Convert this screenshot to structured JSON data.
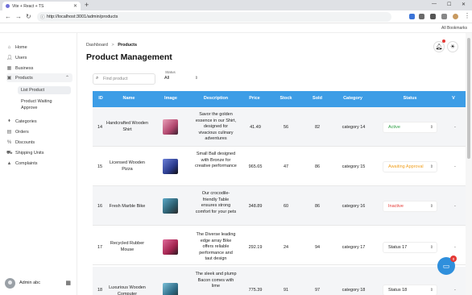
{
  "browser": {
    "tab_title": "Vite + React + TS",
    "url": "http://localhost:3001/admin/products",
    "bookmarks_label": "All Bookmarks"
  },
  "sidebar": {
    "items": [
      {
        "label": "Home",
        "icon": "home-icon"
      },
      {
        "label": "Users",
        "icon": "user-icon"
      },
      {
        "label": "Business",
        "icon": "business-icon"
      },
      {
        "label": "Products",
        "icon": "products-icon"
      },
      {
        "label": "Categories",
        "icon": "tag-icon"
      },
      {
        "label": "Orders",
        "icon": "orders-icon"
      },
      {
        "label": "Discounts",
        "icon": "discount-icon"
      },
      {
        "label": "Shipping Units",
        "icon": "truck-icon"
      },
      {
        "label": "Complaints",
        "icon": "warning-icon"
      }
    ],
    "subitems": [
      {
        "label": "List Product"
      },
      {
        "label": "Product Waiting Approve"
      }
    ],
    "user_name": "Admin abc"
  },
  "header": {
    "breadcrumb_root": "Dashboard",
    "breadcrumb_sep": ">",
    "breadcrumb_current": "Products",
    "title": "Product Management"
  },
  "filters": {
    "search_placeholder": "Find product",
    "status_label": "Status",
    "status_value": "All"
  },
  "table": {
    "headers": [
      "ID",
      "Name",
      "Image",
      "Description",
      "Price",
      "Stock",
      "Sold",
      "Category",
      "Status",
      "V"
    ],
    "rows": [
      {
        "id": "14",
        "name": "Handcrafted Wooden Shirt",
        "desc": "Savor the golden essence in our Shirt, designed for vivacious culinary adventures",
        "price": "41.49",
        "stock": "56",
        "sold": "82",
        "category": "category 14",
        "status": "Active",
        "status_color": "#2e9e44"
      },
      {
        "id": "15",
        "name": "Licensed Wooden Pizza",
        "desc": "Small Ball designed with Bronze for creative performance",
        "price": "965.65",
        "stock": "47",
        "sold": "86",
        "category": "category 15",
        "status": "Awaiting Approval",
        "status_color": "#f0a020"
      },
      {
        "id": "16",
        "name": "Fresh Marble Bike",
        "desc": "Our crocodile-friendly Table ensures strong comfort for your pets",
        "price": "348.89",
        "stock": "60",
        "sold": "86",
        "category": "category 16",
        "status": "Inactive",
        "status_color": "#e53935"
      },
      {
        "id": "17",
        "name": "Recycled Rubber Mouse",
        "desc": "The Diverse leading edge array Bike offers reliable performance and taut design",
        "price": "292.19",
        "stock": "24",
        "sold": "94",
        "category": "category 17",
        "status": "Status 17",
        "status_color": "#222222"
      },
      {
        "id": "18",
        "name": "Luxurious Wooden Computer",
        "desc": "The sleek and plump Bacon comes with lime",
        "price": "775.39",
        "stock": "91",
        "sold": "97",
        "category": "category 18",
        "status": "Status 18",
        "status_color": "#222222"
      }
    ]
  },
  "chat_badge": "0"
}
